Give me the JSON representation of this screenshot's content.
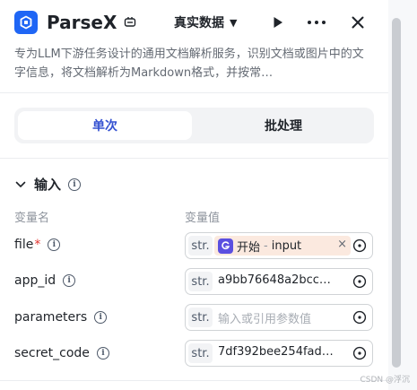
{
  "header": {
    "title": "ParseX",
    "mode": "真实数据",
    "icons": [
      "parsex-logo",
      "plugin-icon",
      "chevron-down-icon",
      "play-icon",
      "more-icon",
      "close-icon"
    ]
  },
  "description": "专为LLM下游任务设计的通用文档解析服务，识别文档或图片中的文字信息，将文档解析为Markdown格式，并按常…",
  "tabs": [
    {
      "label": "单次",
      "active": true
    },
    {
      "label": "批处理",
      "active": false
    }
  ],
  "inputs": {
    "title": "输入",
    "col_name": "变量名",
    "col_value": "变量值",
    "rows": [
      {
        "name": "file",
        "required": "*",
        "type": "str.",
        "ref_source": "开始",
        "ref_sep": "-",
        "ref_var": "input"
      },
      {
        "name": "app_id",
        "type": "str.",
        "value": "a9bb76648a2bcc…"
      },
      {
        "name": "parameters",
        "type": "str.",
        "placeholder": "输入或引用参数值"
      },
      {
        "name": "secret_code",
        "type": "str.",
        "value": "7df392bee254fad…"
      }
    ]
  },
  "watermark": "CSDN @浮沉",
  "colors": {
    "accent": "#3451d1",
    "logo": "#1f66f5",
    "ref_chip": "#fbe9df",
    "ref_icon": "#5b4fe0",
    "required": "#e3342f"
  }
}
